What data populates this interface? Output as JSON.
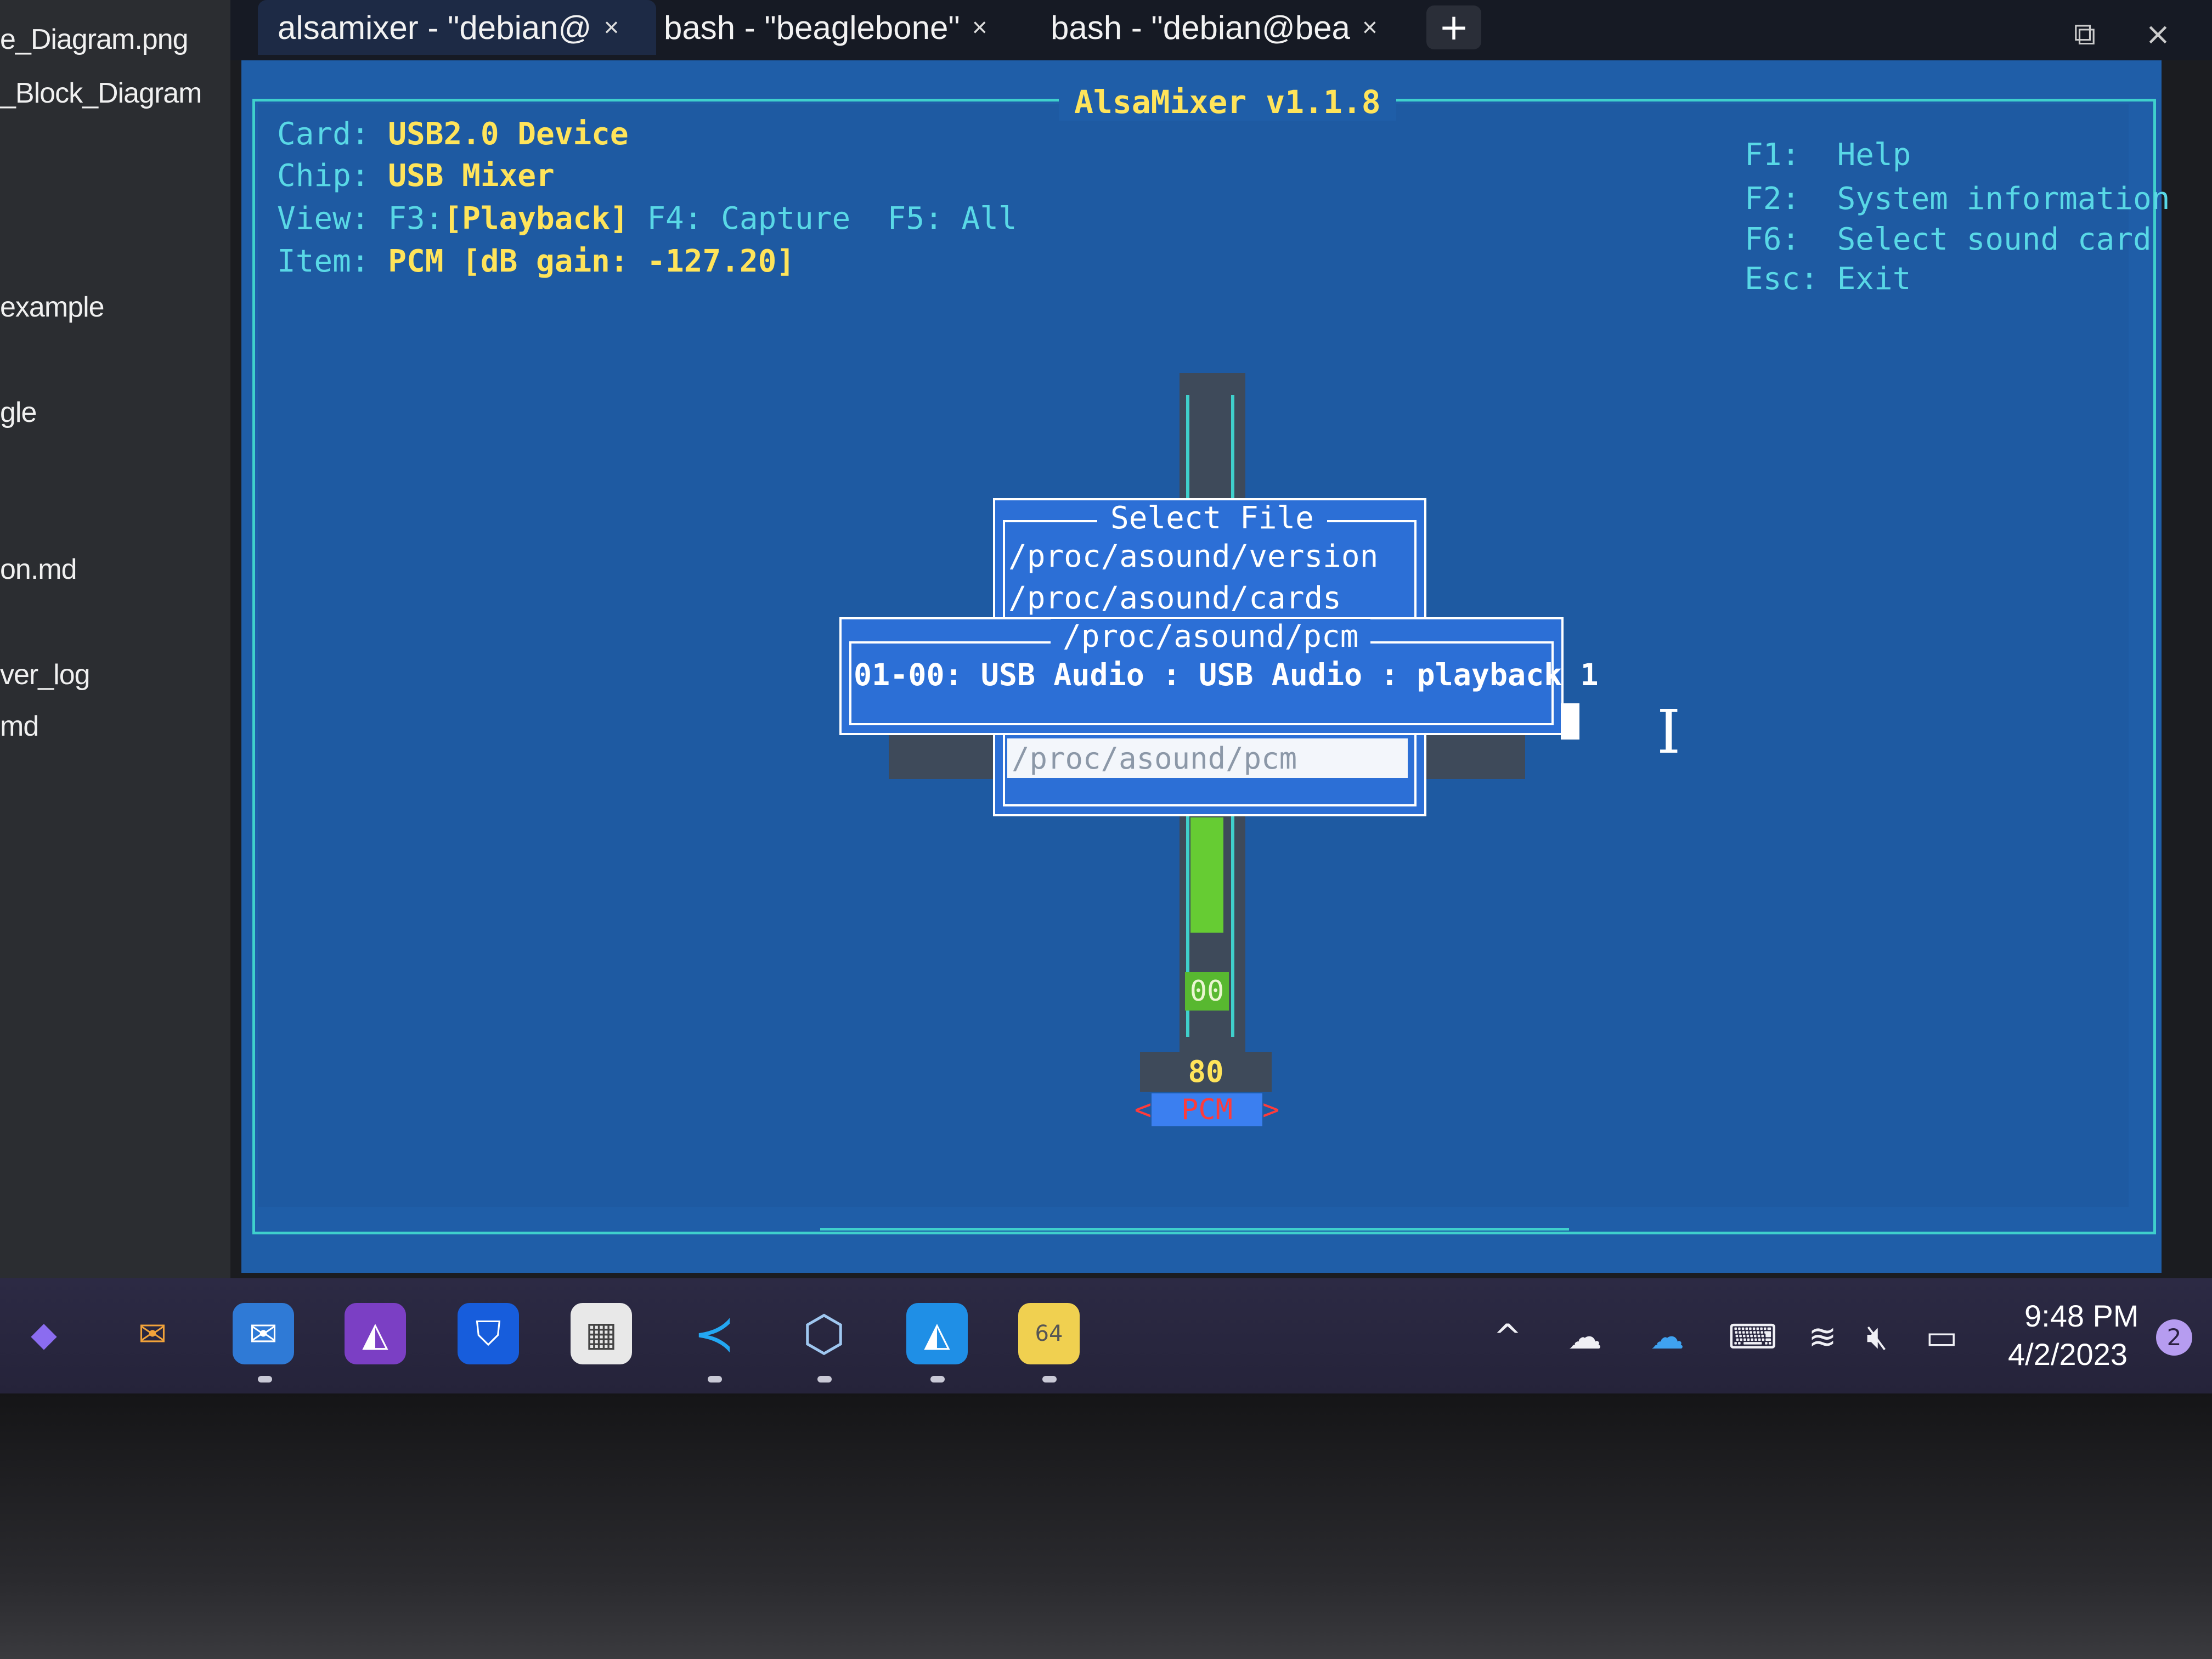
{
  "explorer": {
    "files": [
      "e_Diagram.png",
      "_Block_Diagram",
      "example",
      "gle",
      "on.md",
      "ver_log",
      "md"
    ]
  },
  "tabs": [
    {
      "label": "alsamixer - \"debian@",
      "close": "×"
    },
    {
      "label": "bash - \"beaglebone\"",
      "close": "×"
    },
    {
      "label": "bash - \"debian@bea",
      "close": "×"
    }
  ],
  "window": {
    "new_tab": "+",
    "restore_icon": "⧉",
    "close_icon": "×"
  },
  "mixer": {
    "title": "AlsaMixer v1.1.8",
    "card_label": "Card:",
    "card_value": "USB2.0 Device",
    "chip_label": "Chip:",
    "chip_value": "USB Mixer",
    "view_label": "View:",
    "view_f3_key": "F3:",
    "view_f3_value": "[Playback]",
    "view_f4": "F4: Capture",
    "view_f5": "F5: All",
    "item_label": "Item:",
    "item_value": "PCM [dB gain: -127.20]",
    "help": [
      {
        "key": "F1:",
        "action": "Help"
      },
      {
        "key": "F2:",
        "action": "System information"
      },
      {
        "key": "F6:",
        "action": "Select sound card"
      },
      {
        "key": "Esc:",
        "action": "Exit"
      }
    ],
    "level_value": "00",
    "volume_readout": "80",
    "channel_name": "PCM",
    "channel_left_arrow": "<",
    "channel_right_arrow": ">"
  },
  "select_file_dialog": {
    "title": "Select File",
    "items": [
      "/proc/asound/version",
      "/proc/asound/cards"
    ]
  },
  "pcm_dialog": {
    "title": "/proc/asound/pcm",
    "content": "01-00: USB Audio : USB Audio : playback 1",
    "input_value": "/proc/asound/pcm"
  },
  "taskbar": {
    "apps": [
      {
        "name": "obsidian-icon",
        "glyph": "◆"
      },
      {
        "name": "thunderbird-icon",
        "glyph": "✉"
      },
      {
        "name": "mail-icon",
        "glyph": "✉"
      },
      {
        "name": "affinity-photo-icon",
        "glyph": "◭"
      },
      {
        "name": "bitwarden-icon",
        "glyph": "⛉"
      },
      {
        "name": "photo-editor-icon",
        "glyph": "▦"
      },
      {
        "name": "vscode-icon",
        "glyph": "≺"
      },
      {
        "name": "virtualbox-icon",
        "glyph": "⬡"
      },
      {
        "name": "affinity-designer-icon",
        "glyph": "◭"
      },
      {
        "name": "app-64-icon",
        "glyph": "64"
      }
    ],
    "tray": {
      "chevron": "^",
      "time": "9:48 PM",
      "date": "4/2/2023",
      "notifications": "2"
    }
  }
}
